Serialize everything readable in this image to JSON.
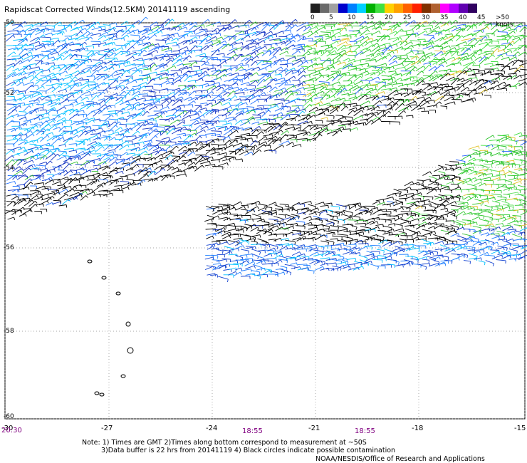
{
  "title": "Rapidscat Corrected Winds(12.5KM) 20141119 ascending",
  "legend": {
    "colors": [
      "#202020",
      "#6a6a6a",
      "#a0a0a0",
      "#0000cc",
      "#0080ff",
      "#00d0ff",
      "#00b000",
      "#40e040",
      "#ffd000",
      "#ffa000",
      "#ff6000",
      "#ff2000",
      "#803000",
      "#b06030",
      "#ff00ff",
      "#b000ff",
      "#6000b0",
      "#300060"
    ],
    "labels": [
      "0",
      "5",
      "10",
      "15",
      "20",
      "25",
      "30",
      "35",
      "40",
      "45",
      ">50 knots"
    ]
  },
  "axes": {
    "lon_ticks": [
      "-30",
      "-27",
      "-24",
      "-21",
      "-18",
      "-15"
    ],
    "lat_ticks": [
      "-50",
      "-52",
      "-54",
      "-56",
      "-58",
      "-60"
    ]
  },
  "times": [
    "20:30",
    "18:55",
    "18:55"
  ],
  "notes": [
    "Note: 1) Times are GMT 2)Times along bottom correspond to measurement at ~50S",
    "3)Data buffer is 22 hrs from 20141119 4) Black circles indicate possible contamination"
  ],
  "agency": "NOAA/NESDIS/Office of Research and Applications"
}
